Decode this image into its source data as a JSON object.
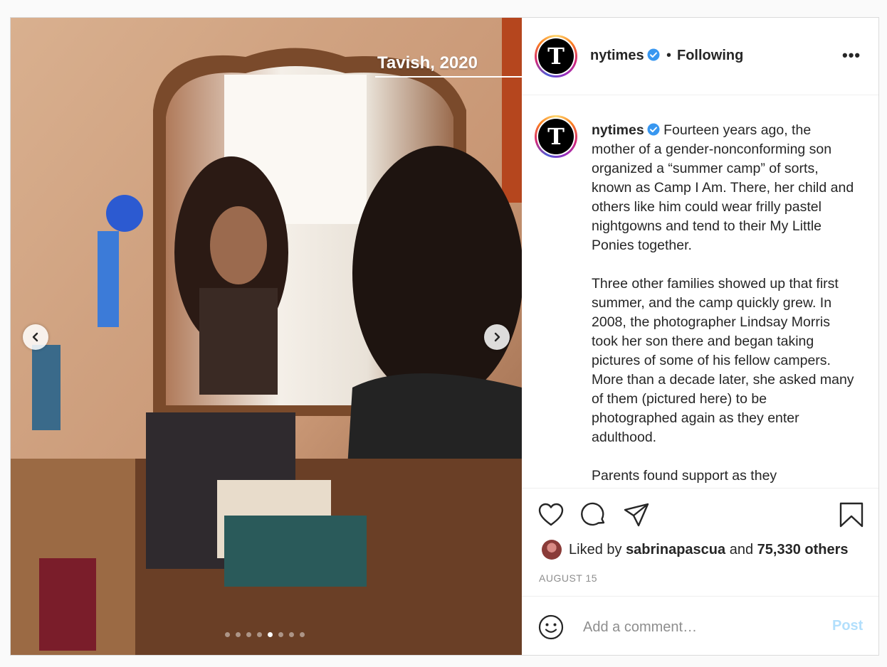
{
  "media": {
    "overlay_caption": "Tavish, 2020",
    "nav_prev_icon": "chevron-left-icon",
    "nav_next_icon": "chevron-right-icon",
    "carousel_total": 8,
    "carousel_active_index": 4
  },
  "header": {
    "username": "nytimes",
    "separator": "•",
    "follow_status": "Following",
    "more_icon": "more-options-icon",
    "more_label": "•••",
    "avatar_glyph": "T"
  },
  "caption": {
    "username": "nytimes",
    "avatar_glyph": "T",
    "paragraphs": [
      "Fourteen years ago, the mother of a gender-nonconforming son organized a “summer camp” of sorts, known as Camp I Am. There, her child and others like him could wear frilly pastel nightgowns and tend to their My Little Ponies together.",
      "Three other families showed up that first summer, and the camp quickly grew. In 2008, the photographer Lindsay Morris took her son there and began taking pictures of some of his fellow campers. More than a decade later, she asked many of them (pictured here) to be photographed again as they enter adulthood.",
      "Parents found support as they"
    ]
  },
  "actions": {
    "like_icon": "heart-icon",
    "comment_icon": "comment-bubble-icon",
    "share_icon": "paper-plane-icon",
    "save_icon": "bookmark-icon"
  },
  "likes": {
    "prefix": "Liked by",
    "user": "sabrinapascua",
    "conj": "and",
    "others": "75,330 others"
  },
  "date": "AUGUST 15",
  "comment": {
    "emoji_icon": "emoji-icon",
    "placeholder": "Add a comment…",
    "post_label": "Post"
  },
  "colors": {
    "verified": "#3897f0",
    "post_disabled": "#b2dffc",
    "muted": "#8e8e8e"
  }
}
